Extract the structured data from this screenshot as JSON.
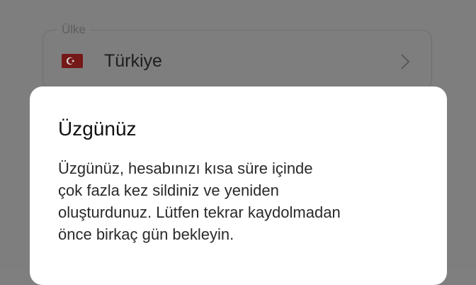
{
  "country_field": {
    "label": "Ülke",
    "value": "Türkiye",
    "flag_icon": "turkey-flag-icon",
    "chevron_icon": "chevron-right-icon"
  },
  "dialog": {
    "title": "Üzgünüz",
    "message_lines": [
      "Üzgünüz, hesabınızı kısa süre içinde",
      "çok fazla kez sildiniz ve yeniden",
      "oluşturdunuz. Lütfen tekrar kaydolmadan",
      "önce birkaç gün bekleyin."
    ]
  },
  "colors": {
    "scrim": "#7e7e7e",
    "dialog_background": "#ffffff",
    "flag_red": "#741818"
  }
}
